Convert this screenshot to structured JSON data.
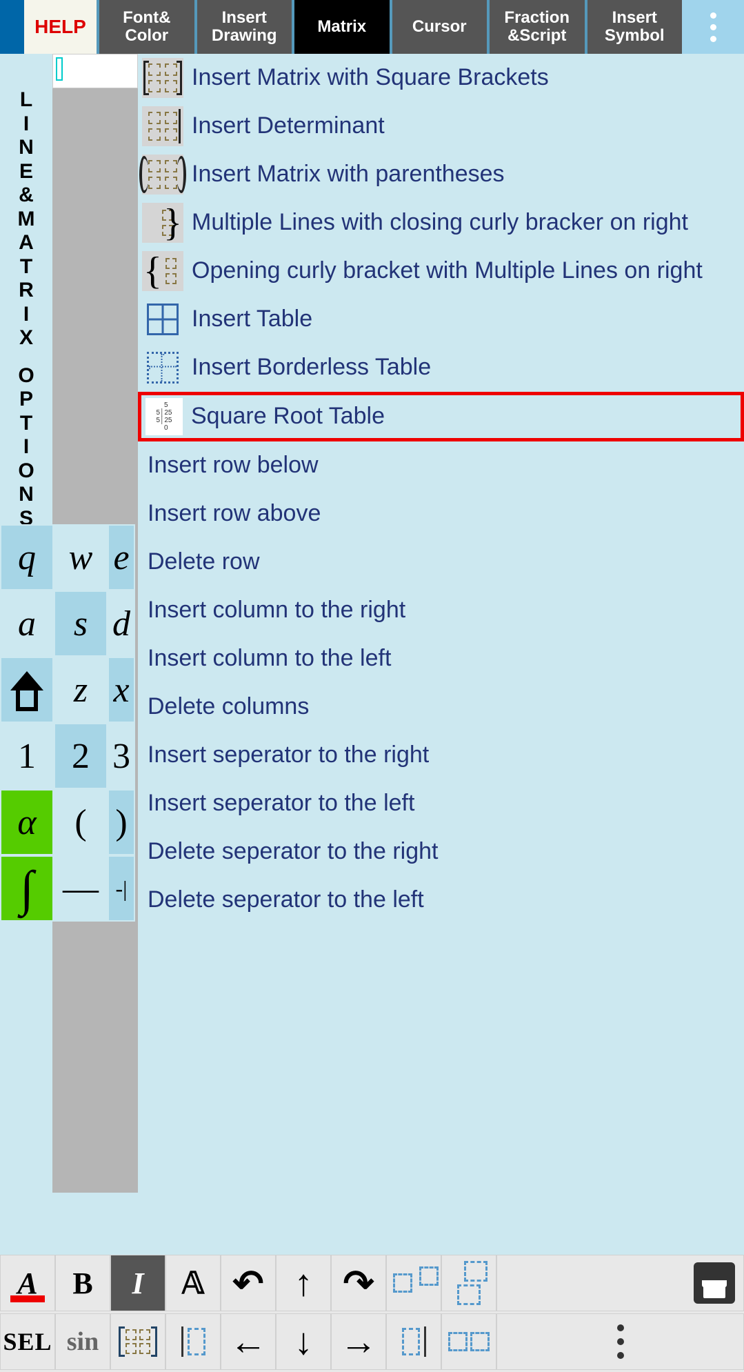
{
  "toolbar": {
    "help": "HELP",
    "tabs": [
      "Font& Color",
      "Insert Drawing",
      "Matrix",
      "Cursor",
      "Fraction &Script",
      "Insert Symbol"
    ],
    "active_index": 2
  },
  "sidebar_label": "LINE&MATRIX OPTIONS",
  "menu": [
    {
      "label": "Insert Matrix with Square Brackets",
      "icon": "matrix-sq"
    },
    {
      "label": "Insert Determinant",
      "icon": "matrix-det"
    },
    {
      "label": "Insert Matrix with parentheses",
      "icon": "matrix-paren"
    },
    {
      "label": "Multiple Lines with closing curly bracker on right",
      "icon": "curly-right"
    },
    {
      "label": "Opening curly bracket with Multiple Lines on right",
      "icon": "curly-left"
    },
    {
      "label": "Insert Table",
      "icon": "table"
    },
    {
      "label": "Insert Borderless Table",
      "icon": "table-dashed"
    },
    {
      "label": "Square Root Table",
      "icon": "sqrt",
      "highlighted": true
    },
    {
      "label": "Insert row below"
    },
    {
      "label": "Insert row above"
    },
    {
      "label": "Delete row"
    },
    {
      "label": "Insert column to the right"
    },
    {
      "label": "Insert column to the left"
    },
    {
      "label": "Delete columns"
    },
    {
      "label": "Insert seperator to the right"
    },
    {
      "label": "Insert seperator to the left"
    },
    {
      "label": "Delete seperator to the right"
    },
    {
      "label": "Delete seperator to the left"
    }
  ],
  "keyboard_rows": [
    [
      "q",
      "w",
      "e"
    ],
    [
      "a",
      "s",
      "d"
    ],
    [
      "⇧",
      "z",
      "x"
    ],
    [
      "1",
      "2",
      "3"
    ],
    [
      "α",
      "(",
      ")"
    ],
    [
      "∫",
      "—",
      "-|"
    ]
  ],
  "bottom_row1": [
    "A",
    "B",
    "I",
    "𝔸",
    "↶",
    "↑",
    "↷",
    "□□",
    "□□",
    "💾"
  ],
  "bottom_row2": [
    "SEL",
    "sin",
    "[□]",
    "|□",
    "←",
    "↓",
    "→",
    "□|",
    "□□",
    "⋮"
  ]
}
